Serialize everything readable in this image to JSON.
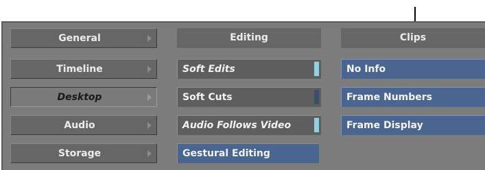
{
  "categories": [
    {
      "label": "General"
    },
    {
      "label": "Timeline"
    },
    {
      "label": "Desktop"
    },
    {
      "label": "Audio"
    },
    {
      "label": "Storage"
    }
  ],
  "editing": {
    "header": "Editing",
    "options": [
      {
        "label": "Soft Edits"
      },
      {
        "label": "Soft Cuts"
      },
      {
        "label": "Audio Follows Video"
      },
      {
        "label": "Gestural Editing"
      }
    ]
  },
  "clips": {
    "header": "Clips",
    "options": [
      {
        "label": "No Info"
      },
      {
        "label": "Frame Numbers"
      },
      {
        "label": "Frame Display"
      }
    ]
  },
  "colors": {
    "panel_bg": "#7c7c7c",
    "button_gray": "#666666",
    "button_blue": "#4a6590",
    "indicator_on": "#8fd2e8"
  }
}
